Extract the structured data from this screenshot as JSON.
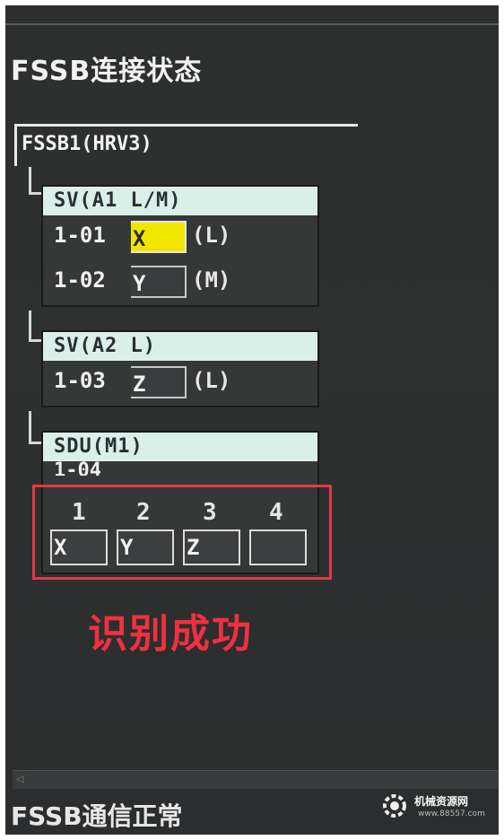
{
  "screen": {
    "title": "FSSB连接状态",
    "status": "FSSB通信正常"
  },
  "fssb": {
    "label": "FSSB1(HRV3)"
  },
  "amplifiers": [
    {
      "header": "SV(A1 L/M)",
      "rows": [
        {
          "num": "1-01",
          "axis": "X",
          "mode": "(L)",
          "active": true
        },
        {
          "num": "1-02",
          "axis": "Y",
          "mode": "(M)",
          "active": false
        }
      ]
    },
    {
      "header": "SV(A2 L)",
      "rows": [
        {
          "num": "1-03",
          "axis": "Z",
          "mode": "(L)",
          "active": false
        }
      ]
    }
  ],
  "sdu": {
    "header": "SDU(M1)",
    "number": "1-04",
    "slots": [
      {
        "num": "1",
        "axis": "X"
      },
      {
        "num": "2",
        "axis": "Y"
      },
      {
        "num": "3",
        "axis": "Z"
      },
      {
        "num": "4",
        "axis": ""
      }
    ]
  },
  "annotation": {
    "text": "识别成功",
    "color": "#f03040"
  },
  "scrollbar": {
    "left_arrow_icon": "arrow-left-icon"
  },
  "watermark": {
    "logo_icon": "gear-icon",
    "name": "机械资源网",
    "url": "www.88557.com"
  },
  "colors": {
    "active_axis": "#f2e600",
    "header_bg": "#d9efe8",
    "highlight_frame": "#e23a44"
  }
}
